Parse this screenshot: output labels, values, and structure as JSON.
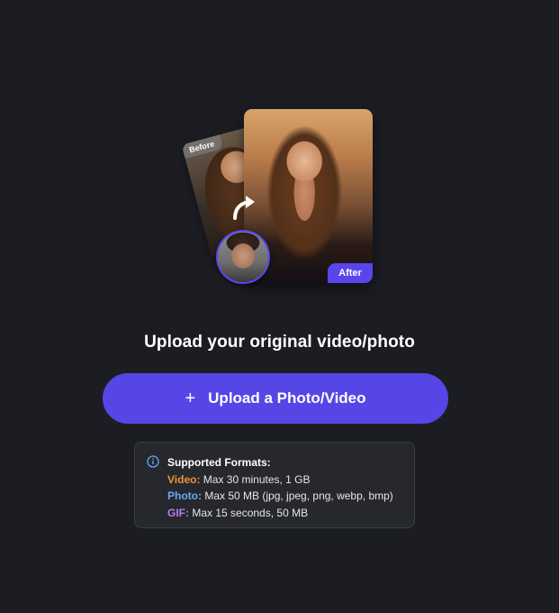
{
  "illustration": {
    "before_label": "Before",
    "after_label": "After"
  },
  "heading": "Upload your original video/photo",
  "upload_button": {
    "icon": "plus-icon",
    "label": "Upload a Photo/Video",
    "color": "#5746e6"
  },
  "formats": {
    "icon": "info-icon",
    "title": "Supported Formats:",
    "items": [
      {
        "key": "Video:",
        "value": "Max 30 minutes, 1 GB",
        "color": "#f0913a"
      },
      {
        "key": "Photo:",
        "value": "Max 50 MB (jpg, jpeg, png, webp, bmp)",
        "color": "#6aa7f5"
      },
      {
        "key": "GIF:",
        "value": "Max 15 seconds, 50 MB",
        "color": "#b77df2"
      }
    ]
  }
}
